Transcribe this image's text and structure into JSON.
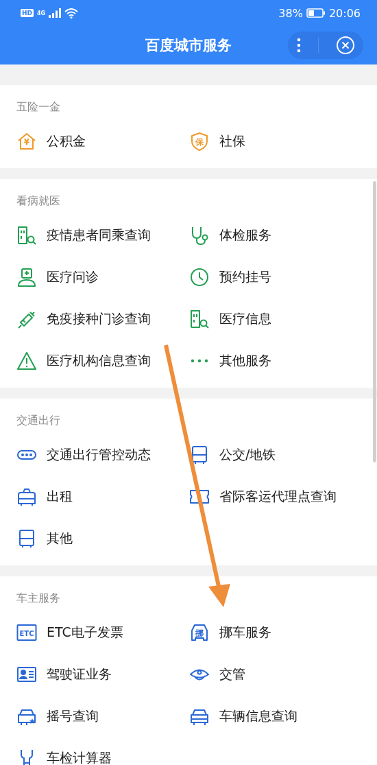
{
  "status_bar": {
    "hd": "HD",
    "network": "4G",
    "battery": "38%",
    "time": "20:06"
  },
  "header": {
    "title": "百度城市服务"
  },
  "sections": [
    {
      "title": "五险一金",
      "color": "#ee9a2c",
      "items": [
        {
          "label": "公积金",
          "badge": "¥"
        },
        {
          "label": "社保",
          "badge": "保"
        }
      ]
    },
    {
      "title": "看病就医",
      "color": "#22a052",
      "items": [
        {
          "label": "疫情患者同乘查询"
        },
        {
          "label": "体检服务"
        },
        {
          "label": "医疗问诊"
        },
        {
          "label": "预约挂号"
        },
        {
          "label": "免疫接种门诊查询"
        },
        {
          "label": "医疗信息"
        },
        {
          "label": "医疗机构信息查询"
        },
        {
          "label": "其他服务"
        }
      ]
    },
    {
      "title": "交通出行",
      "color": "#2a68d6",
      "items": [
        {
          "label": "交通出行管控动态"
        },
        {
          "label": "公交/地铁"
        },
        {
          "label": "出租"
        },
        {
          "label": "省际客运代理点查询"
        },
        {
          "label": "其他"
        }
      ]
    },
    {
      "title": "车主服务",
      "color": "#2a68d6",
      "items": [
        {
          "label": "ETC电子发票",
          "badge": "ETC"
        },
        {
          "label": "挪车服务",
          "badge": "挪"
        },
        {
          "label": "驾驶证业务"
        },
        {
          "label": "交管"
        },
        {
          "label": "摇号查询"
        },
        {
          "label": "车辆信息查询"
        },
        {
          "label": "车检计算器"
        }
      ]
    }
  ]
}
